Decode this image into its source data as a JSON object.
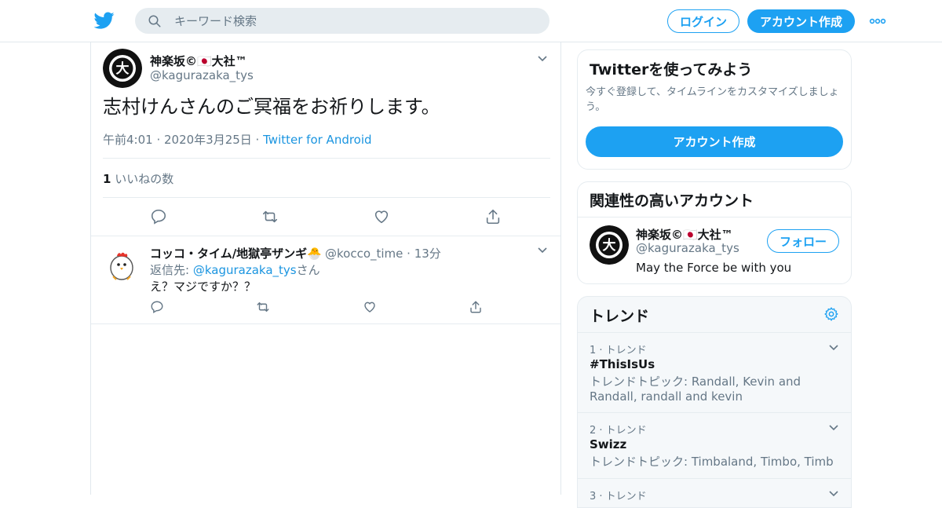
{
  "colors": {
    "accent": "#1da1f2",
    "link": "#1b95e0",
    "muted": "#657786",
    "like": "#e0245e"
  },
  "header": {
    "search_placeholder": "キーワード検索",
    "login_label": "ログイン",
    "signup_label": "アカウント作成"
  },
  "tweet": {
    "name": "神楽坂©🇯🇵大社™",
    "handle": "@kagurazaka_tys",
    "text": "志村けんさんのご冥福をお祈りします。",
    "time": "午前4:01 · 2020年3月25日 ·",
    "source": "Twitter for Android",
    "like_count": "1",
    "like_label": "いいねの数"
  },
  "reply": {
    "name": "コッコ・タイム/地獄亭ザンギ🐣",
    "handle": "@kocco_time",
    "time": "· 13分",
    "reply_prefix": "返信先:",
    "reply_to": "@kagurazaka_tys",
    "reply_suffix": "さん",
    "text": "え？マジですか？？"
  },
  "sidebar": {
    "signup_card": {
      "title": "Twitterを使ってみよう",
      "desc": "今すぐ登録して、タイムラインをカスタマイズしましょう。",
      "button": "アカウント作成"
    },
    "related": {
      "title": "関連性の高いアカウント",
      "name": "神楽坂©🇯🇵大社™",
      "handle": "@kagurazaka_tys",
      "bio": "May the Force be with you",
      "follow": "フォロー"
    },
    "trends": {
      "title": "トレンド",
      "items": [
        {
          "rank": "1 · トレンド",
          "name": "#ThisIsUs",
          "desc": "トレンドトピック: Randall, Kevin and Randall, randall and kevin"
        },
        {
          "rank": "2 · トレンド",
          "name": "Swizz",
          "desc": "トレンドトピック: Timbaland, Timbo, Timb"
        },
        {
          "rank": "3 · トレンド",
          "name": "",
          "desc": ""
        }
      ]
    }
  }
}
